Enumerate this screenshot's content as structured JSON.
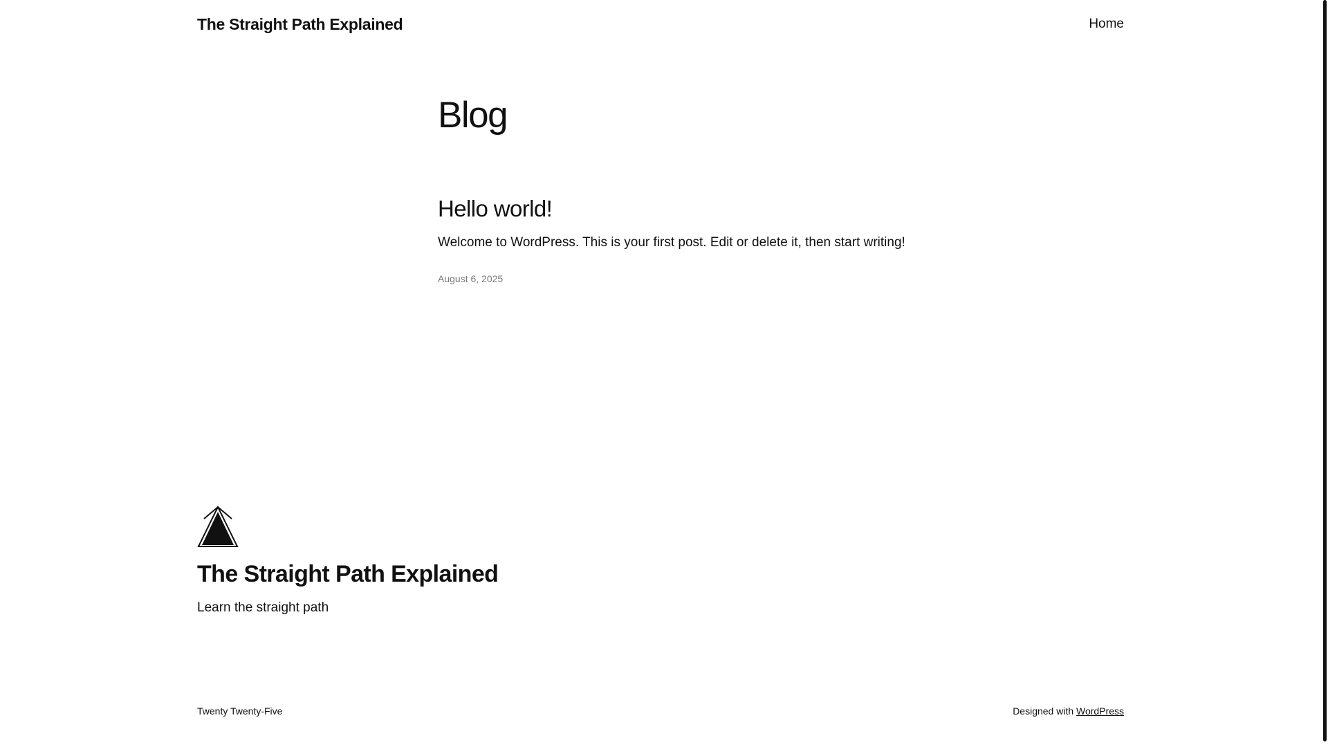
{
  "header": {
    "site_title": "The Straight Path Explained",
    "nav": {
      "home_label": "Home"
    }
  },
  "main": {
    "page_title": "Blog",
    "posts": [
      {
        "title": "Hello world!",
        "excerpt": "Welcome to WordPress. This is your first post. Edit or delete it, then start writing!",
        "date": "August 6, 2025"
      }
    ]
  },
  "footer": {
    "logo_icon": "upward-arrow-triangle-icon",
    "site_title": "The Straight Path Explained",
    "tagline": "Learn the straight path",
    "theme_name": "Twenty Twenty-Five",
    "credit_prefix": "Designed with",
    "credit_link": "WordPress"
  },
  "colors": {
    "text": "#111111",
    "muted": "#7a7a7a",
    "background": "#ffffff"
  }
}
